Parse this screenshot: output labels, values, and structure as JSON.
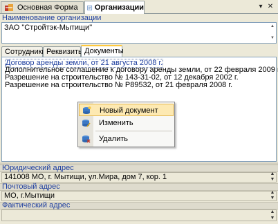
{
  "doc_tabs": [
    {
      "label": "Основная Форма",
      "icon": "form-icon"
    },
    {
      "label": "Организации",
      "icon": "organizations-icon"
    }
  ],
  "window_buttons": {
    "menu": "▾",
    "close": "✕"
  },
  "org_name": {
    "label": "Наименование организации",
    "value": "ЗАО \"Стройтэк-Мытищи\""
  },
  "inner_tabs": [
    "Сотрудники",
    "Реквизиты",
    "Документы"
  ],
  "documents": [
    "Договор аренды земли, от 21 августа 2008 г.",
    "Дополнительное соглашение к договору аренды земли, от 22 февраля 2009 г.",
    "Разрешение на строительство № 143-31-02, от 12 декабря 2002 г.",
    "Разрешение на строительство № Р89532, от 21 февраля 2008 г."
  ],
  "context_menu": [
    {
      "label": "Новый документ",
      "icon": "new-document-icon"
    },
    {
      "label": "Изменить",
      "icon": "edit-icon"
    },
    {
      "label": "Удалить",
      "icon": "delete-icon"
    }
  ],
  "legal_address": {
    "label": "Юридический адрес",
    "value": "141008 МО, г. Мытищи, ул.Мира, дом 7, кор. 1"
  },
  "postal_address": {
    "label": "Почтовый адрес",
    "value": "МО, г.Мытищи"
  },
  "actual_address": {
    "label": "Фактический адрес",
    "value": ""
  },
  "colors": {
    "label_blue": "#1f3f9f",
    "highlight": "#fde9b2",
    "active_tab_accent": "#ffc83c"
  }
}
